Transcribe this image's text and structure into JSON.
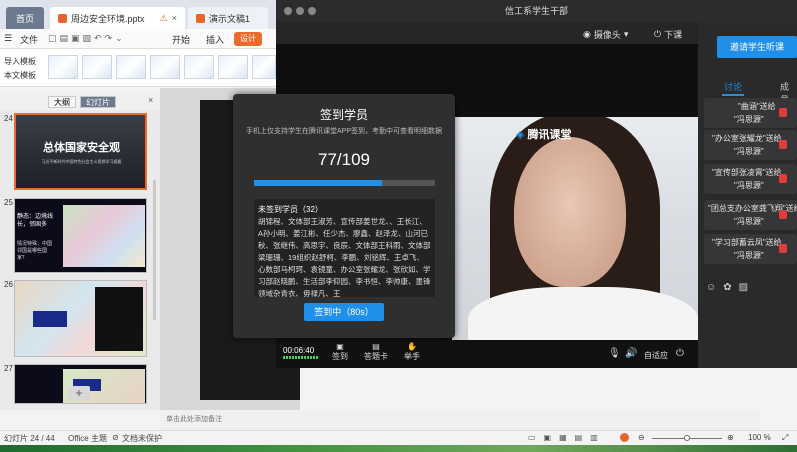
{
  "wps": {
    "tabs": [
      {
        "label": "首页"
      },
      {
        "label": "周边安全环境.pptx"
      },
      {
        "label": "演示文稿1"
      }
    ],
    "toolbar": {
      "file_label": "文件",
      "start_label": "开始",
      "insert_label": "插入",
      "design_label": "设计"
    },
    "ribbon": {
      "import_template": "导入模板",
      "this_template": "本文模板"
    },
    "panel_tabs": {
      "outline": "大纲",
      "slides": "幻灯片"
    },
    "slides": [
      {
        "num": "24",
        "title": "总体国家安全观",
        "subtitle": "习近平新时代中国特色社会主义思想学习纲要"
      },
      {
        "num": "25",
        "text": "静态：边境线长，邻国多",
        "text2": "情况特殊：中国邻国是哪些国家？"
      },
      {
        "num": "26"
      },
      {
        "num": "27"
      }
    ],
    "notes_placeholder": "单击此处添加备注",
    "status": {
      "slide_count": "幻灯片 24 / 44",
      "theme": "Office 主题",
      "protect": "文档未保护",
      "zoom": "100 %"
    }
  },
  "classroom": {
    "title": "信工系学生干部",
    "camera_label": "摄像头",
    "end_class_label": "下课",
    "invite_label": "邀请学生听课",
    "tabs": {
      "discuss": "讨论",
      "members": "成员"
    },
    "brand": "腾讯课堂",
    "messages": [
      {
        "from": "\"曲涵\"送给",
        "to": "\"冯思源\""
      },
      {
        "from": "\"办公室张耀龙\"送给",
        "to": "\"冯思源\""
      },
      {
        "from": "\"宣传部张凌霄\"送给",
        "to": "\"冯思源\""
      },
      {
        "from": "\"团总支办公室龚飞翔\"送给",
        "to": "\"冯思源\""
      },
      {
        "from": "\"学习部蓄云凤\"送给",
        "to": "\"冯思源\""
      }
    ],
    "controls": {
      "time": "00:06:40",
      "signin": "签到",
      "answer_card": "答题卡",
      "raise_hand": "举手",
      "adapt": "自适应"
    }
  },
  "signin_modal": {
    "title": "签到学员",
    "subtitle": "手机上仅支持学生在腾讯课堂APP签到，考勤中可查看明细数据",
    "count": "77/109",
    "progress": 0.706,
    "unsigned_header": "未签到学员（32）",
    "unsigned_list": "胡锦程、文体部王淑芳、宣传部姜世龙、、王长江、A孙小明、姜江彬、任少杰、廖鑫、赵泽龙、山河已秋、张继伟、高思宇、良辰、文体部王科雨、文体部梁珊珊、19组织赵舒柯、李鹏、刘铭辉、王卓飞、心数部马柯珂、袁镜童、办公室张耀龙、张欣如、学习部赵晓鹏、生活部李仰园、李书恒、李帅康、墨锋领域杂青衣、毋禄凡、王",
    "button_label": "签到中（80s）"
  },
  "colors": {
    "accent": "#1f8fe8",
    "wps_orange": "#ea6b2c"
  }
}
